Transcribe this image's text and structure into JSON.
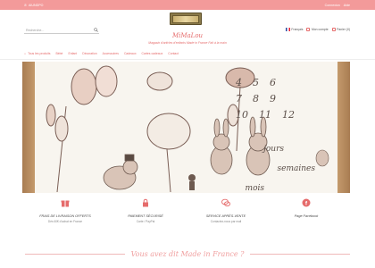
{
  "topbar": {
    "left_text": "AIUNDPO",
    "right_links": [
      "Connexion",
      "Aide"
    ]
  },
  "search": {
    "placeholder": "Recherche..."
  },
  "brand": {
    "title": "MiMaLou",
    "subtitle": "Magasin d'articles d'enfants Made in France Fait à la main"
  },
  "account": {
    "items": [
      "Français",
      "Mon compte",
      "Panier (0)"
    ]
  },
  "nav": {
    "items": [
      "Tous les produits",
      "Bébé",
      "Enfant",
      "Décoration",
      "Accessoires",
      "Cadeaux",
      "Cartes cadeaux",
      "Contact"
    ]
  },
  "hero": {
    "numbers": [
      [
        "4",
        "5",
        "6"
      ],
      [
        "7",
        "8",
        "9"
      ],
      [
        "10",
        "11",
        "12"
      ]
    ],
    "words": [
      "jours",
      "semaines",
      "mois"
    ]
  },
  "features": [
    {
      "title": "FRAIS DE LIVRAISON OFFERTS",
      "sub": "Dès 60€ d'achat en France"
    },
    {
      "title": "PAIEMENT SÉCURISÉ",
      "sub": "Carte / PayPal"
    },
    {
      "title": "SERVICE APRÈS-VENTE",
      "sub": "Contactez-nous par mail"
    },
    {
      "title": "Page Facebook",
      "sub": ""
    }
  ],
  "bottom": {
    "title": "Vous avez dit Made in France ?"
  },
  "colors": {
    "accent": "#f39a9a",
    "brand": "#e56b6b"
  }
}
